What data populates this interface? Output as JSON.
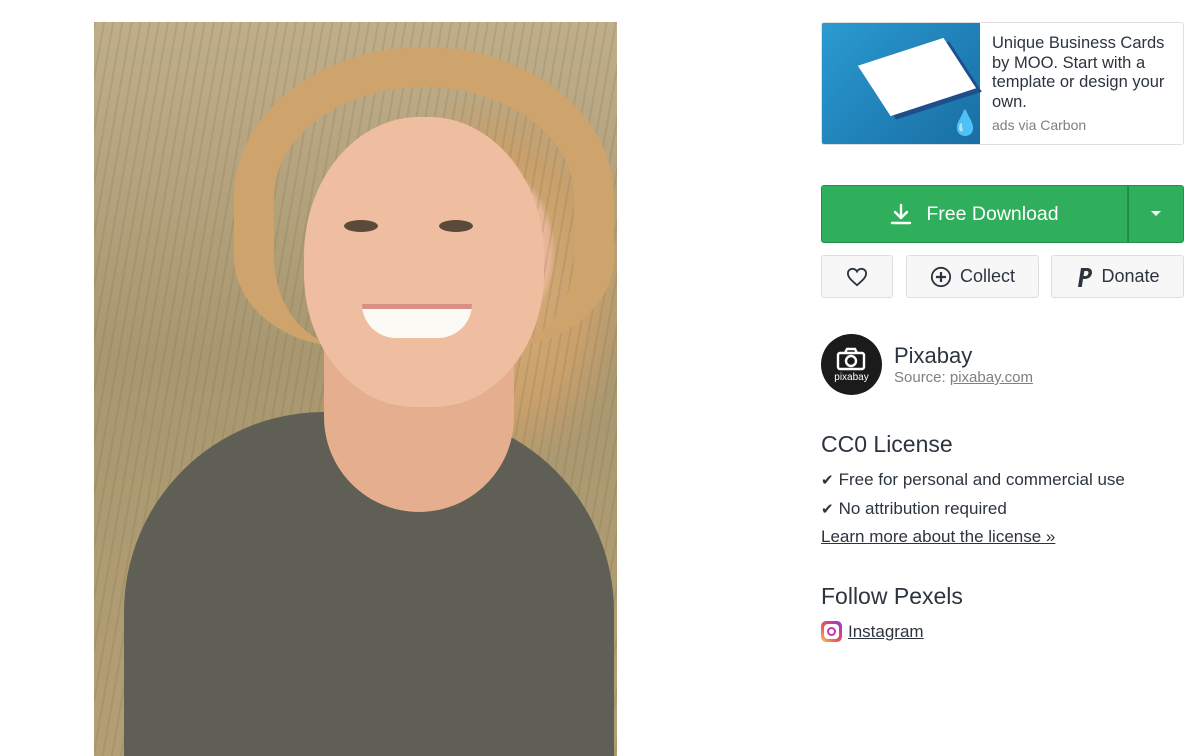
{
  "photo": {
    "alt_icon": "photo-woman-smiling"
  },
  "ad": {
    "text": "Unique Business Cards by MOO. Start with a template or design your own.",
    "via": "ads via Carbon"
  },
  "download": {
    "label": "Free Download",
    "icon": "download-icon",
    "caret_icon": "caret-down-icon",
    "color": "#2fae5b"
  },
  "actions": {
    "like_icon": "heart-icon",
    "collect_label": "Collect",
    "collect_icon": "plus-circle-icon",
    "donate_label": "Donate",
    "donate_icon": "paypal-icon"
  },
  "author": {
    "name": "Pixabay",
    "source_prefix": "Source:",
    "source_link": "pixabay.com",
    "avatar_text": "pixabay"
  },
  "license": {
    "title": "CC0 License",
    "items": [
      "Free for personal and commercial use",
      "No attribution required"
    ],
    "check": "✔",
    "learn_more": "Learn more about the license »"
  },
  "follow": {
    "title": "Follow Pexels",
    "instagram_label": "Instagram"
  }
}
